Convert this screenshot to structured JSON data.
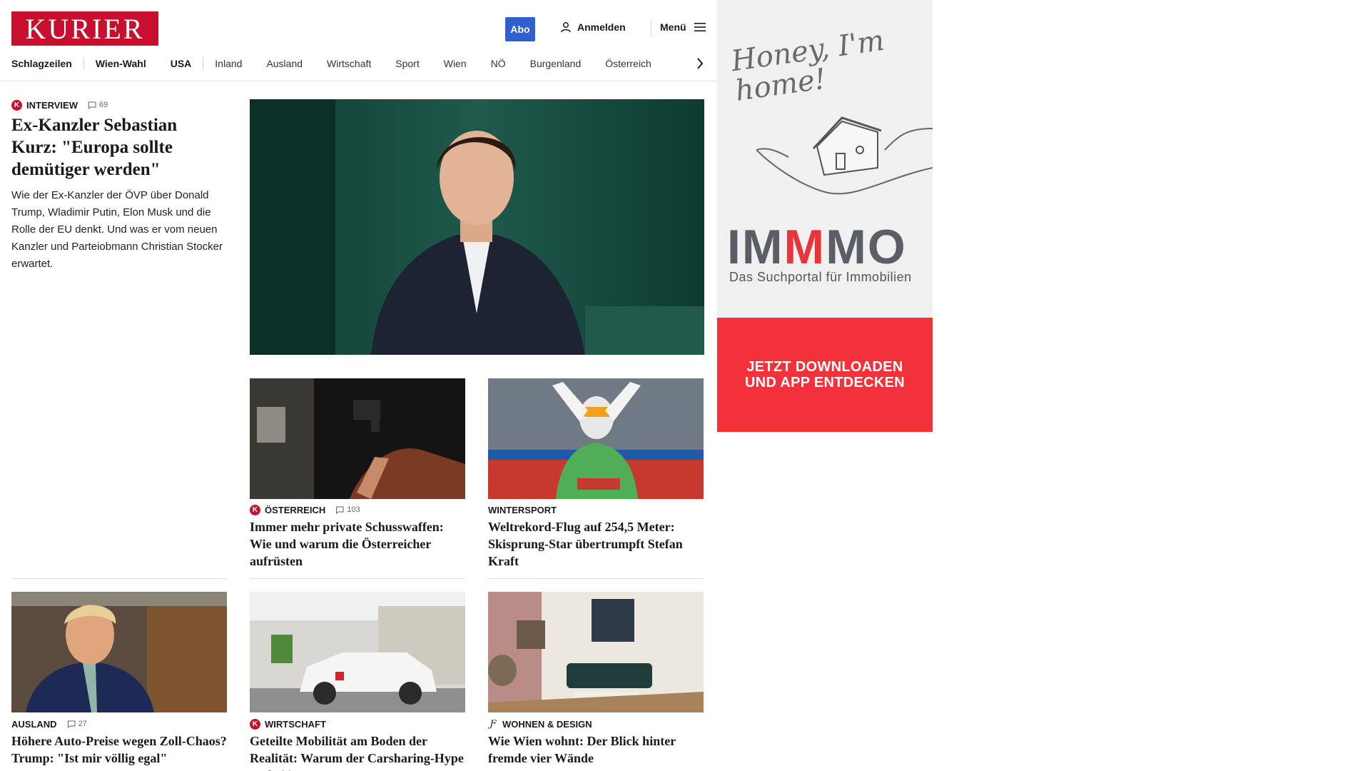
{
  "brand": {
    "logo_text": "KURIER",
    "accent": "#c8102e"
  },
  "header": {
    "abo_label": "Abo",
    "login_label": "Anmelden",
    "menu_label": "Menü"
  },
  "nav": {
    "items": [
      "Schlagzeilen",
      "Wien-Wahl",
      "USA",
      "Inland",
      "Ausland",
      "Wirtschaft",
      "Sport",
      "Wien",
      "NÖ",
      "Burgenland",
      "Österreich"
    ]
  },
  "lead": {
    "category": "INTERVIEW",
    "comments": "69",
    "title": "Ex-Kanzler Sebastian Kurz: \"Europa sollte demütiger werden\"",
    "teaser": "Wie der Ex-Kanzler der ÖVP über Donald Trump, Wladimir Putin, Elon Musk und die Rolle der EU denkt. Und was er vom neuen Kanzler und Parteiobmann Christian Stocker erwartet."
  },
  "articles": [
    {
      "category": "ÖSTERREICH",
      "comments": "103",
      "title": "Immer mehr private Schusswaffen: Wie und warum die Österreicher aufrüsten"
    },
    {
      "category": "WINTERSPORT",
      "comments": "",
      "title": "Weltrekord-Flug auf 254,5 Meter: Skisprung-Star übertrumpft Stefan Kraft"
    },
    {
      "category": "AUSLAND",
      "comments": "27",
      "title": "Höhere Auto-Preise wegen Zoll-Chaos? Trump: \"Ist mir völlig egal\""
    },
    {
      "category": "WIRTSCHAFT",
      "comments": "",
      "title": "Geteilte Mobilität am Boden der Realität: Warum der Carsharing-Hype vorbei ist"
    },
    {
      "category": "WOHNEN & DESIGN",
      "comments": "",
      "title": "Wie Wien wohnt: Der Blick hinter fremde vier Wände"
    }
  ],
  "ad": {
    "tagline": "Honey, I'm home!",
    "brand_a": "IM",
    "brand_b": "M",
    "brand_c": "MO",
    "subtitle": "Das Suchportal für Immobilien",
    "cta_line1": "JETZT DOWNLOADEN",
    "cta_line2": "UND APP ENTDECKEN"
  }
}
